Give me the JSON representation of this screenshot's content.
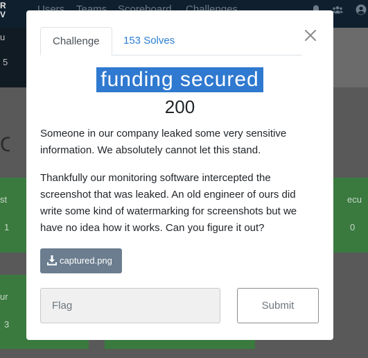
{
  "navbar": {
    "brand": "R\nV",
    "links": [
      "Users",
      "Teams",
      "Scoreboard",
      "Challenges"
    ],
    "icons": [
      "bell-icon",
      "team-icon",
      "user-icon"
    ]
  },
  "hero": {
    "text_top": "u",
    "text_bottom": "5"
  },
  "category_heading": "C",
  "cards": [
    {
      "title": "st",
      "value": "1"
    },
    {
      "title": "ecu",
      "value": "0"
    },
    {
      "title": "ur",
      "value": "3"
    }
  ],
  "modal": {
    "tabs": {
      "challenge": "Challenge",
      "solves": "153 Solves"
    },
    "close_symbol": "×",
    "title": "funding secured",
    "value": "200",
    "description_p1": "Someone in our company leaked some very sensitive information. We absolutely cannot let this stand.",
    "description_p2": "Thankfully our monitoring software intercepted the screenshot that was leaked. An old engineer of ours did write some kind of watermarking for screenshots but we have no idea how it works. Can you figure it out?",
    "file": {
      "label": "captured.png",
      "icon": "download-icon"
    },
    "flag_placeholder": "Flag",
    "flag_value": "",
    "submit_label": "Submit"
  },
  "colors": {
    "accent": "#2f79d0",
    "navbar": "#0f1f2e",
    "card_green": "#3a7a3f",
    "file_button": "#6b7d8f"
  }
}
